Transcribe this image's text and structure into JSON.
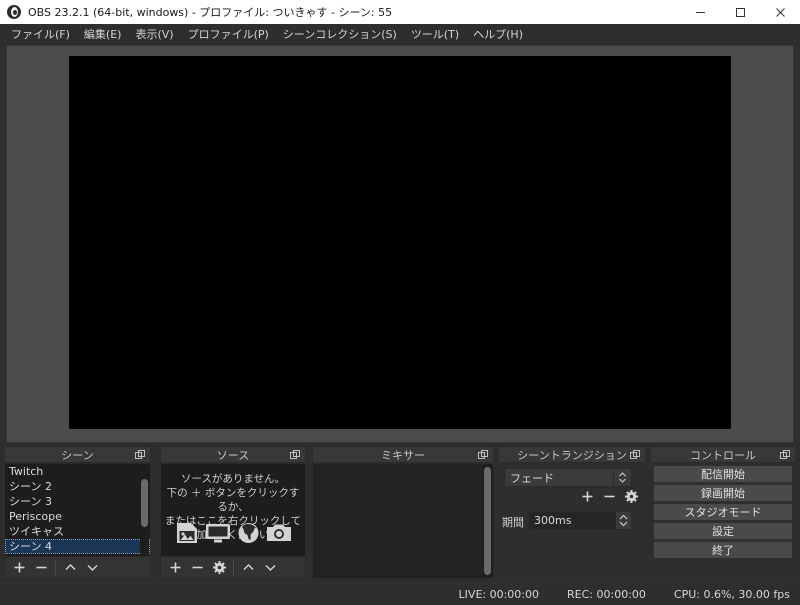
{
  "window": {
    "title": "OBS 23.2.1 (64-bit, windows) - プロファイル: ついきゃす - シーン: 55",
    "logo_icon": "obs-logo-icon",
    "minimize_icon": "minimize-icon",
    "maximize_icon": "maximize-icon",
    "close_icon": "close-icon"
  },
  "menubar": {
    "items": [
      {
        "label": "ファイル(F)"
      },
      {
        "label": "編集(E)"
      },
      {
        "label": "表示(V)"
      },
      {
        "label": "プロファイル(P)"
      },
      {
        "label": "シーンコレクション(S)"
      },
      {
        "label": "ツール(T)"
      },
      {
        "label": "ヘルプ(H)"
      }
    ]
  },
  "scenes": {
    "title": "シーン",
    "float_icon": "undock-icon",
    "items": [
      {
        "label": "Twitch",
        "selected": false
      },
      {
        "label": "シーン 2",
        "selected": false
      },
      {
        "label": "シーン 3",
        "selected": false
      },
      {
        "label": "Periscope",
        "selected": false
      },
      {
        "label": "ツイキャス",
        "selected": false
      },
      {
        "label": "シーン 4",
        "selected": true
      }
    ],
    "toolbar": {
      "add_icon": "plus-icon",
      "remove_icon": "minus-icon",
      "up_icon": "chevron-up-icon",
      "down_icon": "chevron-down-icon"
    }
  },
  "sources": {
    "title": "ソース",
    "float_icon": "undock-icon",
    "empty_line1": "ソースがありません。",
    "empty_line2": "下の ＋ ボタンをクリックするか、",
    "empty_line3": "またはここを右クリックして追加してください。",
    "icons": [
      {
        "name": "image-source-icon"
      },
      {
        "name": "display-capture-icon"
      },
      {
        "name": "browser-source-icon"
      },
      {
        "name": "camera-source-icon"
      }
    ],
    "toolbar": {
      "add_icon": "plus-icon",
      "remove_icon": "minus-icon",
      "properties_icon": "gear-icon",
      "up_icon": "chevron-up-icon",
      "down_icon": "chevron-down-icon"
    }
  },
  "mixer": {
    "title": "ミキサー",
    "float_icon": "undock-icon"
  },
  "transitions": {
    "title": "シーントランジション",
    "float_icon": "undock-icon",
    "selected_transition": "フェード",
    "dropdown_icon": "updown-arrows-icon",
    "add_icon": "plus-icon",
    "remove_icon": "minus-icon",
    "settings_icon": "gear-icon",
    "duration_label": "期間",
    "duration_value": "300ms",
    "spin_up_icon": "chevron-up-icon",
    "spin_down_icon": "chevron-down-icon"
  },
  "controls": {
    "title": "コントロール",
    "float_icon": "undock-icon",
    "buttons": [
      {
        "label": "配信開始"
      },
      {
        "label": "録画開始"
      },
      {
        "label": "スタジオモード"
      },
      {
        "label": "設定"
      },
      {
        "label": "終了"
      }
    ]
  },
  "statusbar": {
    "live": "LIVE: 00:00:00",
    "rec": "REC: 00:00:00",
    "cpu": "CPU: 0.6%, 30.00 fps"
  },
  "colors": {
    "window_bg": "#2e2e2e",
    "panel_header": "#383838",
    "list_bg": "#1d1d1d",
    "selection": "#1b3556",
    "button_face": "#4a4a4a",
    "preview_bg": "#4c4c4c",
    "canvas": "#000000"
  }
}
